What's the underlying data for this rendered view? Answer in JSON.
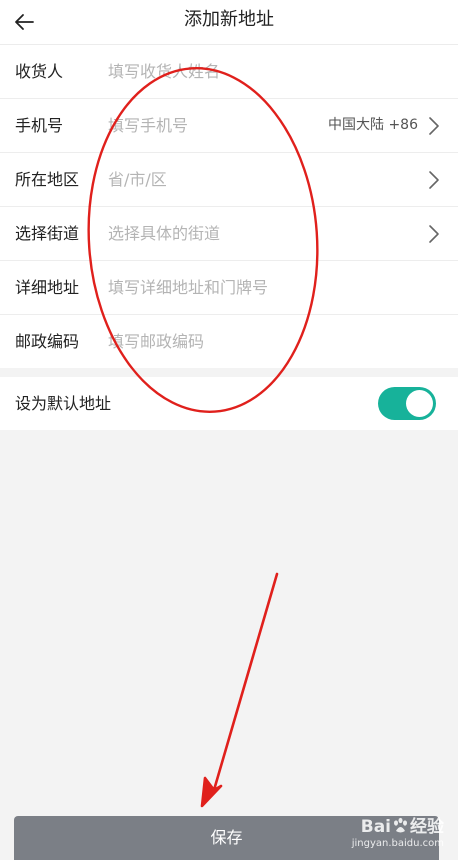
{
  "header": {
    "title": "添加新地址",
    "back_icon": "arrow-left-icon"
  },
  "form": {
    "recipient": {
      "label": "收货人",
      "placeholder": "填写收货人姓名"
    },
    "phone": {
      "label": "手机号",
      "placeholder": "填写手机号",
      "country_code": "中国大陆 +86"
    },
    "region": {
      "label": "所在地区",
      "value": "省/市/区"
    },
    "street": {
      "label": "选择街道",
      "value": "选择具体的街道"
    },
    "address": {
      "label": "详细地址",
      "placeholder": "填写详细地址和门牌号"
    },
    "postcode": {
      "label": "邮政编码",
      "placeholder": "填写邮政编码"
    }
  },
  "default_address": {
    "label": "设为默认地址",
    "enabled": true
  },
  "save_label": "保存",
  "watermark": {
    "brand_left": "Bai",
    "brand_right": "经验",
    "url": "jingyan.baidu.com"
  },
  "colors": {
    "accent": "#17b29a",
    "annotation": "#e0201c",
    "save_button": "#7b7f86"
  }
}
